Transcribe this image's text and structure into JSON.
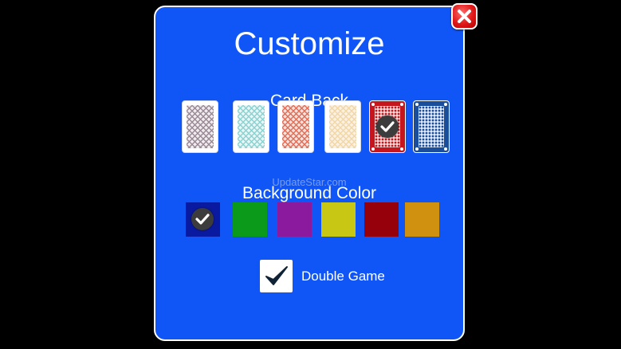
{
  "dialog": {
    "title": "Customize",
    "close_icon": "close-x-icon"
  },
  "card_back": {
    "label": "Card Back",
    "selected_index": 4,
    "options": [
      {
        "name": "gray-diamond-pattern",
        "color": "#9a8a96"
      },
      {
        "name": "teal-diamond-pattern",
        "color": "#8ed1d1"
      },
      {
        "name": "orange-diamond-pattern",
        "color": "#e0705a"
      },
      {
        "name": "cream-diamond-pattern",
        "color": "#f1d7a8"
      },
      {
        "name": "red-bordered-pattern",
        "color": "#c4161c"
      },
      {
        "name": "blue-bordered-pattern",
        "color": "#1a4e9a"
      }
    ]
  },
  "watermark": "UpdateStar.com",
  "background_color": {
    "label": "Background Color",
    "selected_index": 0,
    "swatches": [
      "#0a1aa0",
      "#0c9a1a",
      "#8c1a9e",
      "#c8c814",
      "#96000a",
      "#d09010"
    ]
  },
  "double_game": {
    "label": "Double Game",
    "checked": true
  },
  "colors": {
    "dialog_bg": "#1055f5",
    "screen_bg": "#000000"
  }
}
